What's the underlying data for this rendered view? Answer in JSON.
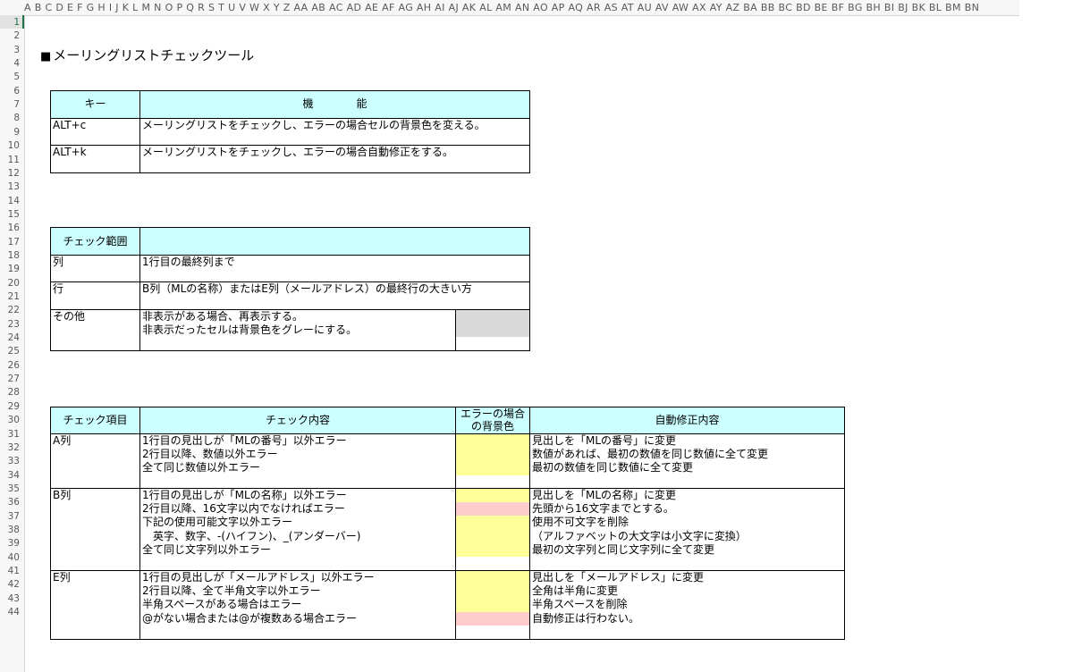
{
  "spreadsheet": {
    "column_headers": "A B C D E F G H I J K L M N O P Q R S T U V W X Y Z AA AB AC AD AE AF AG AH AI AJ AK AL AM AN AO AP AQ AR AS AT AU AV AW AX AY AZ BA BB BC BD BE BF BG BH BI BJ BK BL BM BN",
    "row_numbers": [
      "1",
      "2",
      "3",
      "4",
      "5",
      "6",
      "7",
      "8",
      "9",
      "10",
      "11",
      "12",
      "13",
      "14",
      "15",
      "16",
      "17",
      "18",
      "19",
      "20",
      "21",
      "22",
      "23",
      "24",
      "25",
      "26",
      "27",
      "28",
      "29",
      "30",
      "31",
      "32",
      "33",
      "34",
      "35",
      "36",
      "37",
      "38",
      "39",
      "40",
      "41",
      "42",
      "43",
      "44"
    ]
  },
  "title": {
    "marker": "■",
    "text": "メーリングリストチェックツール"
  },
  "shortcuts_table": {
    "header_key": "キー",
    "header_function": "機　　　　能",
    "rows": [
      {
        "key": "ALT+c",
        "description": "メーリングリストをチェックし、エラーの場合セルの背景色を変える。"
      },
      {
        "key": "ALT+k",
        "description": "メーリングリストをチェックし、エラーの場合自動修正をする。"
      }
    ]
  },
  "range_table": {
    "header": "チェック範囲",
    "rows": [
      {
        "label": "列",
        "lines": [
          "1行目の最終列まで"
        ]
      },
      {
        "label": "行",
        "lines": [
          "B列（MLの名称）またはE列（メールアドレス）の最終行の大きい方"
        ]
      },
      {
        "label": "その他",
        "lines": [
          "非表示がある場合、再表示する。",
          "非表示だったセルは背景色をグレーにする。"
        ]
      }
    ]
  },
  "checks_table": {
    "headers": {
      "item": "チェック項目",
      "content": "チェック内容",
      "error_bg_line1": "エラーの場合",
      "error_bg_line2": "の背景色",
      "auto_fix": "自動修正内容"
    },
    "groups": [
      {
        "label": "A列",
        "content": [
          "1行目の見出しが「MLの番号」以外エラー",
          "2行目以降、数値以外エラー",
          "全て同じ数値以外エラー"
        ],
        "fix": [
          "見出しを「MLの番号」に変更",
          "数値があれば、最初の数値を同じ数値に全て変更",
          "最初の数値を同じ数値に全て変更"
        ]
      },
      {
        "label": "B列",
        "content": [
          "1行目の見出しが「MLの名称」以外エラー",
          "2行目以降、16文字以内でなければエラー",
          "下記の使用可能文字以外エラー",
          "　英字、数字、-(ハイフン)、_(アンダーバー)",
          "全て同じ文字列以外エラー"
        ],
        "fix": [
          "見出しを「MLの名称」に変更",
          "先頭から16文字までとする。",
          "使用不可文字を削除",
          "（アルファベットの大文字は小文字に変換）",
          "最初の文字列と同じ文字列に全て変更"
        ]
      },
      {
        "label": "E列",
        "content": [
          "1行目の見出しが「メールアドレス」以外エラー",
          "2行目以降、全て半角文字以外エラー",
          "半角スペースがある場合はエラー",
          "@がない場合または@が複数ある場合エラー"
        ],
        "fix": [
          "見出しを「メールアドレス」に変更",
          "全角は半角に変更",
          "半角スペースを削除",
          "自動修正は行わない。"
        ]
      }
    ]
  },
  "colors": {
    "header_fill": "#ccffff",
    "error_yellow": "#ffff99",
    "error_pink": "#ffcccc",
    "hidden_gray": "#d9d9d9"
  }
}
